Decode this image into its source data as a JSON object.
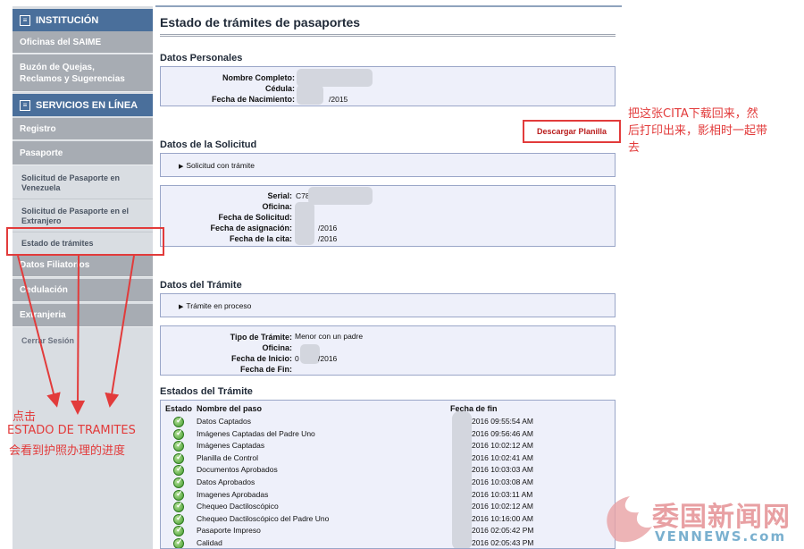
{
  "sidebar": {
    "sections": [
      {
        "label": "INSTITUCIÓN",
        "icon": "square-box-icon"
      },
      {
        "label": "SERVICIOS EN LÍNEA",
        "icon": "square-box-icon"
      }
    ],
    "items": [
      "Oficinas del SAIME",
      "Buzón de Quejas,\nReclamos y Sugerencias",
      "Registro",
      "Pasaporte",
      "Datos Filiatorios",
      "Cedulación",
      "Extranjeria"
    ],
    "subitems": [
      "Solicitud de Pasaporte en Venezuela",
      "Solicitud de Pasaporte en el Extranjero",
      "Estado de trámites"
    ],
    "logout": "Cerrar Sesión"
  },
  "page": {
    "title": "Estado de trámites de pasaportes",
    "download_button": "Descargar Planilla"
  },
  "personal": {
    "heading": "Datos Personales",
    "labels": [
      "Nombre Completo:",
      "Cédula:",
      "Fecha de Nacimiento:"
    ],
    "birth_suffix": "/2015"
  },
  "solicitud": {
    "heading": "Datos de la Solicitud",
    "status": "Solicitud con trámite",
    "labels": [
      "Serial:",
      "Oficina:",
      "Fecha de Solicitud:",
      "Fecha de asignación:",
      "Fecha de la cita:"
    ],
    "serial_prefix": "C78",
    "assign_suffix": "/2016",
    "cita_suffix": "/2016"
  },
  "tramite": {
    "heading": "Datos del Trámite",
    "status": "Trámite en proceso",
    "labels": [
      "Tipo de Trámite:",
      "Oficina:",
      "Fecha de Inicio:",
      "Fecha de Fin:"
    ],
    "tipo": "Menor con un padre",
    "inicio_prefix": "0",
    "inicio_suffix": "/2016"
  },
  "estados": {
    "heading": "Estados del Trámite",
    "columns": [
      "Estado",
      "Nombre del paso",
      "Fecha de fin"
    ],
    "rows": [
      {
        "name": "Datos Captados",
        "date": "2016 09:55:54 AM"
      },
      {
        "name": "Imágenes Captadas del Padre Uno",
        "date": "2016 09:56:46 AM"
      },
      {
        "name": "Imágenes Captadas",
        "date": "2016 10:02:12 AM"
      },
      {
        "name": "Planilla de Control",
        "date": "2016 10:02:41 AM"
      },
      {
        "name": "Documentos Aprobados",
        "date": "2016 10:03:03 AM"
      },
      {
        "name": "Datos Aprobados",
        "date": "2016 10:03:08 AM"
      },
      {
        "name": "Imagenes Aprobadas",
        "date": "2016 10:03:11 AM"
      },
      {
        "name": "Chequeo Dactiloscópico",
        "date": "2016 10:02:12 AM"
      },
      {
        "name": "Chequeo Dactiloscópico del Padre Uno",
        "date": "2016 10:16:00 AM"
      },
      {
        "name": "Pasaporte Impreso",
        "date": "2016 02:05:42 PM"
      },
      {
        "name": "Calidad",
        "date": "2016 02:05:43 PM"
      }
    ]
  },
  "annotations": {
    "download_note": "把这张CITA下载回来，然\n后打印出来，影相时一起带\n去",
    "click_note_1": "点击",
    "click_note_2": "ESTADO DE TRAMITES",
    "click_note_3": "会看到护照办理的进度",
    "color": "#e23b3b"
  },
  "watermark": {
    "title": "委国新闻网",
    "sub": "VENNEWS.com"
  }
}
